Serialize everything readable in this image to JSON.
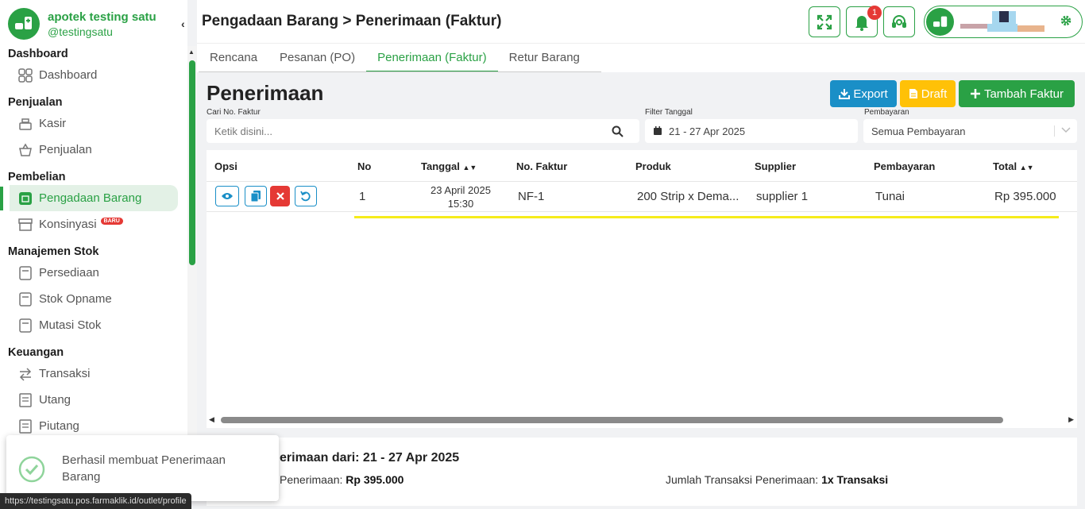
{
  "brand": {
    "name": "apotek testing satu",
    "handle": "@testingsatu"
  },
  "sidebar": {
    "sections": [
      {
        "title": "Dashboard",
        "items": [
          {
            "label": "Dashboard",
            "icon": "grid-icon"
          }
        ]
      },
      {
        "title": "Penjualan",
        "items": [
          {
            "label": "Kasir",
            "icon": "cash-register-icon"
          },
          {
            "label": "Penjualan",
            "icon": "basket-icon"
          }
        ]
      },
      {
        "title": "Pembelian",
        "items": [
          {
            "label": "Pengadaan Barang",
            "icon": "procurement-icon",
            "active": true
          },
          {
            "label": "Konsinyasi",
            "icon": "archive-icon",
            "badge": "BARU"
          }
        ]
      },
      {
        "title": "Manajemen Stok",
        "items": [
          {
            "label": "Persediaan",
            "icon": "inventory-icon"
          },
          {
            "label": "Stok Opname",
            "icon": "stock-opname-icon"
          },
          {
            "label": "Mutasi Stok",
            "icon": "stock-mutation-icon"
          }
        ]
      },
      {
        "title": "Keuangan",
        "items": [
          {
            "label": "Transaksi",
            "icon": "transfer-icon"
          },
          {
            "label": "Utang",
            "icon": "receipt-icon"
          },
          {
            "label": "Piutang",
            "icon": "receipt-icon"
          }
        ]
      }
    ]
  },
  "header": {
    "title": "Pengadaan Barang > Penerimaan (Faktur)",
    "notification_count": "1"
  },
  "tabs": [
    "Rencana",
    "Pesanan (PO)",
    "Penerimaan (Faktur)",
    "Retur Barang"
  ],
  "active_tab": "Penerimaan (Faktur)",
  "main": {
    "title": "Penerimaan",
    "actions": {
      "export": "Export",
      "draft": "Draft",
      "add": "Tambah Faktur"
    },
    "filters": {
      "search_label": "Cari No. Faktur",
      "search_placeholder": "Ketik disini...",
      "date_label": "Filter Tanggal",
      "date_value": "21 - 27 Apr 2025",
      "payment_label": "Pembayaran",
      "payment_value": "Semua Pembayaran"
    }
  },
  "table": {
    "columns": [
      "Opsi",
      "No",
      "Tanggal",
      "No. Faktur",
      "Produk",
      "Supplier",
      "Pembayaran",
      "Total"
    ],
    "rows": [
      {
        "no": "1",
        "date": "23 April 2025",
        "time": "15:30",
        "invoice": "NF-1",
        "product": "200 Strip x Dema...",
        "supplier": "supplier 1",
        "payment": "Tunai",
        "total": "Rp 395.000"
      }
    ]
  },
  "summary": {
    "title": "erimaan dari: 21 - 27 Apr 2025",
    "total_label": "Penerimaan:",
    "total_value": "Rp 395.000",
    "count_label": "Jumlah Transaksi Penerimaan:",
    "count_value": "1x Transaksi"
  },
  "toast": {
    "message": "Berhasil membuat Penerimaan Barang"
  },
  "status_url": "https://testingsatu.pos.farmaklik.id/outlet/profile",
  "colors": {
    "primary": "#2aa145",
    "info": "#1a8fc7",
    "warning": "#ffc107",
    "danger": "#e53935"
  }
}
